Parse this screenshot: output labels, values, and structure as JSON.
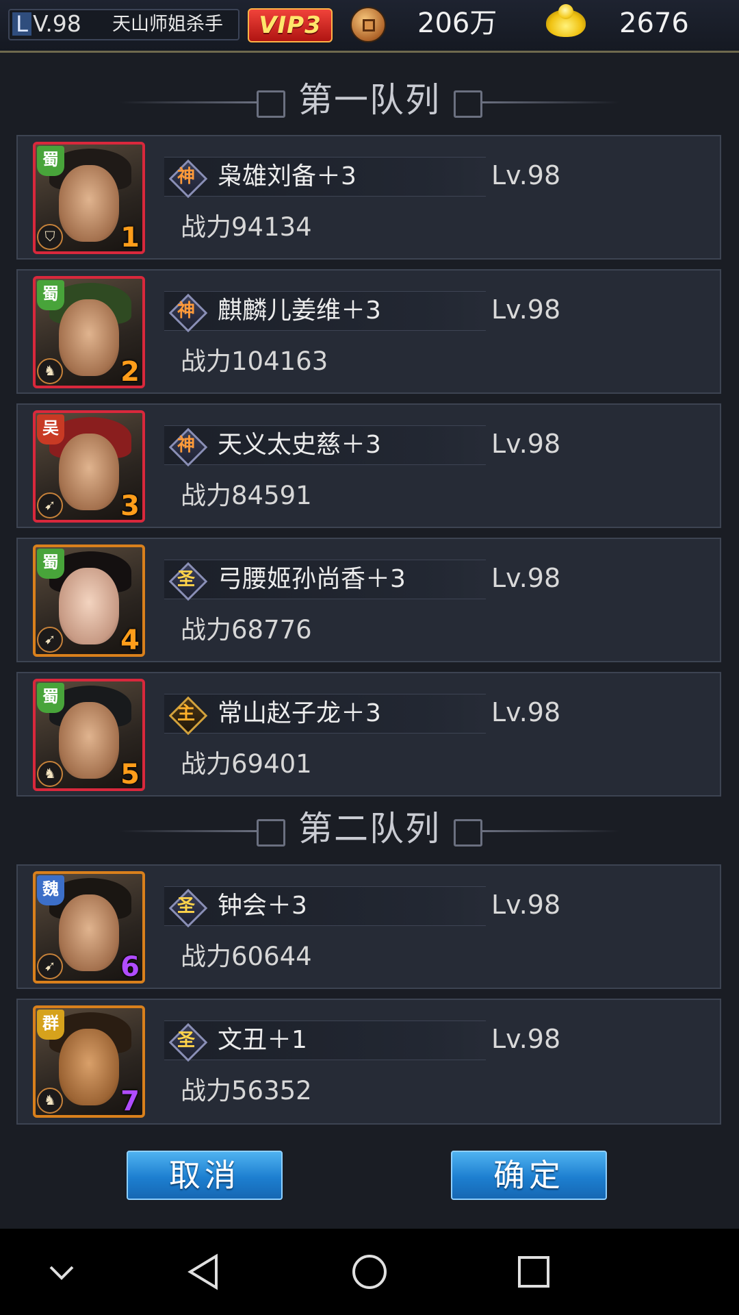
{
  "topbar": {
    "level_letter": "L",
    "level_text": "V.98",
    "player_name": "天山师姐杀手",
    "vip": "VIP3",
    "copper_icon": "copper-coin-icon",
    "copper": "206万",
    "gold_icon": "gold-ingot-icon",
    "gold": "2676"
  },
  "sections": [
    {
      "title": "第一队列"
    },
    {
      "title": "第二队列"
    }
  ],
  "heroes": [
    {
      "faction": "蜀",
      "slot": "1",
      "rank_glyph": "神",
      "name": "枭雄刘备＋3",
      "level": "Lv.98",
      "power": "战力94134",
      "unit": "shield-icon"
    },
    {
      "faction": "蜀",
      "slot": "2",
      "rank_glyph": "神",
      "name": "麒麟儿姜维＋3",
      "level": "Lv.98",
      "power": "战力104163",
      "unit": "horse-icon"
    },
    {
      "faction": "吴",
      "slot": "3",
      "rank_glyph": "神",
      "name": "天义太史慈＋3",
      "level": "Lv.98",
      "power": "战力84591",
      "unit": "bow-icon"
    },
    {
      "faction": "蜀",
      "slot": "4",
      "rank_glyph": "圣",
      "name": "弓腰姬孙尚香＋3",
      "level": "Lv.98",
      "power": "战力68776",
      "unit": "bow-icon"
    },
    {
      "faction": "蜀",
      "slot": "5",
      "rank_glyph": "主",
      "name": "常山赵子龙＋3",
      "level": "Lv.98",
      "power": "战力69401",
      "unit": "horse-icon"
    },
    {
      "faction": "魏",
      "slot": "6",
      "rank_glyph": "圣",
      "name": "钟会＋3",
      "level": "Lv.98",
      "power": "战力60644",
      "unit": "bow-icon"
    },
    {
      "faction": "群",
      "slot": "7",
      "rank_glyph": "圣",
      "name": "文丑＋1",
      "level": "Lv.98",
      "power": "战力56352",
      "unit": "horse-icon"
    }
  ],
  "buttons": {
    "cancel": "取消",
    "confirm": "确定"
  },
  "colors": {
    "shu": "#48a43a",
    "wu": "#c83a24",
    "wei": "#3c6fc8",
    "qun": "#d6a21c",
    "button": "#1d7fd0"
  }
}
